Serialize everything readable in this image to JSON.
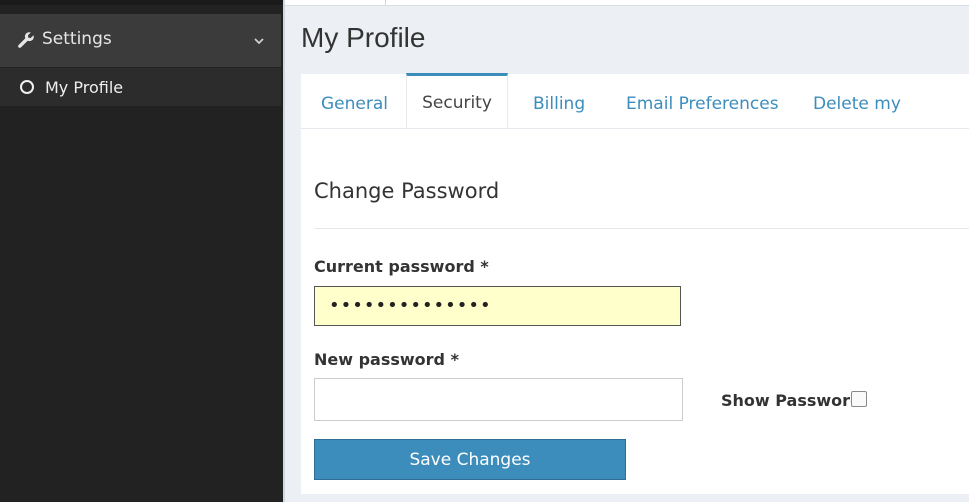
{
  "sidebar": {
    "menu_header_label": "Settings",
    "items": [
      {
        "label": "My Profile"
      }
    ]
  },
  "page": {
    "title": "My Profile"
  },
  "tabs": [
    {
      "label": "General"
    },
    {
      "label": "Security",
      "active": true
    },
    {
      "label": "Billing"
    },
    {
      "label": "Email Preferences"
    },
    {
      "label": "Delete my Account"
    }
  ],
  "form": {
    "section_title": "Change Password",
    "current_password_label": "Current password *",
    "current_password_value": "••••••••••••••",
    "new_password_label": "New password *",
    "new_password_value": "",
    "show_password_label": "Show Password",
    "show_password_checked": false,
    "save_label": "Save Changes"
  },
  "colors": {
    "accent": "#3c8dbc",
    "sidebar_bg": "#222222",
    "autofill_bg": "#ffffcc"
  },
  "icons": [
    "wrench-icon",
    "chevron-down-icon",
    "circle-icon"
  ]
}
